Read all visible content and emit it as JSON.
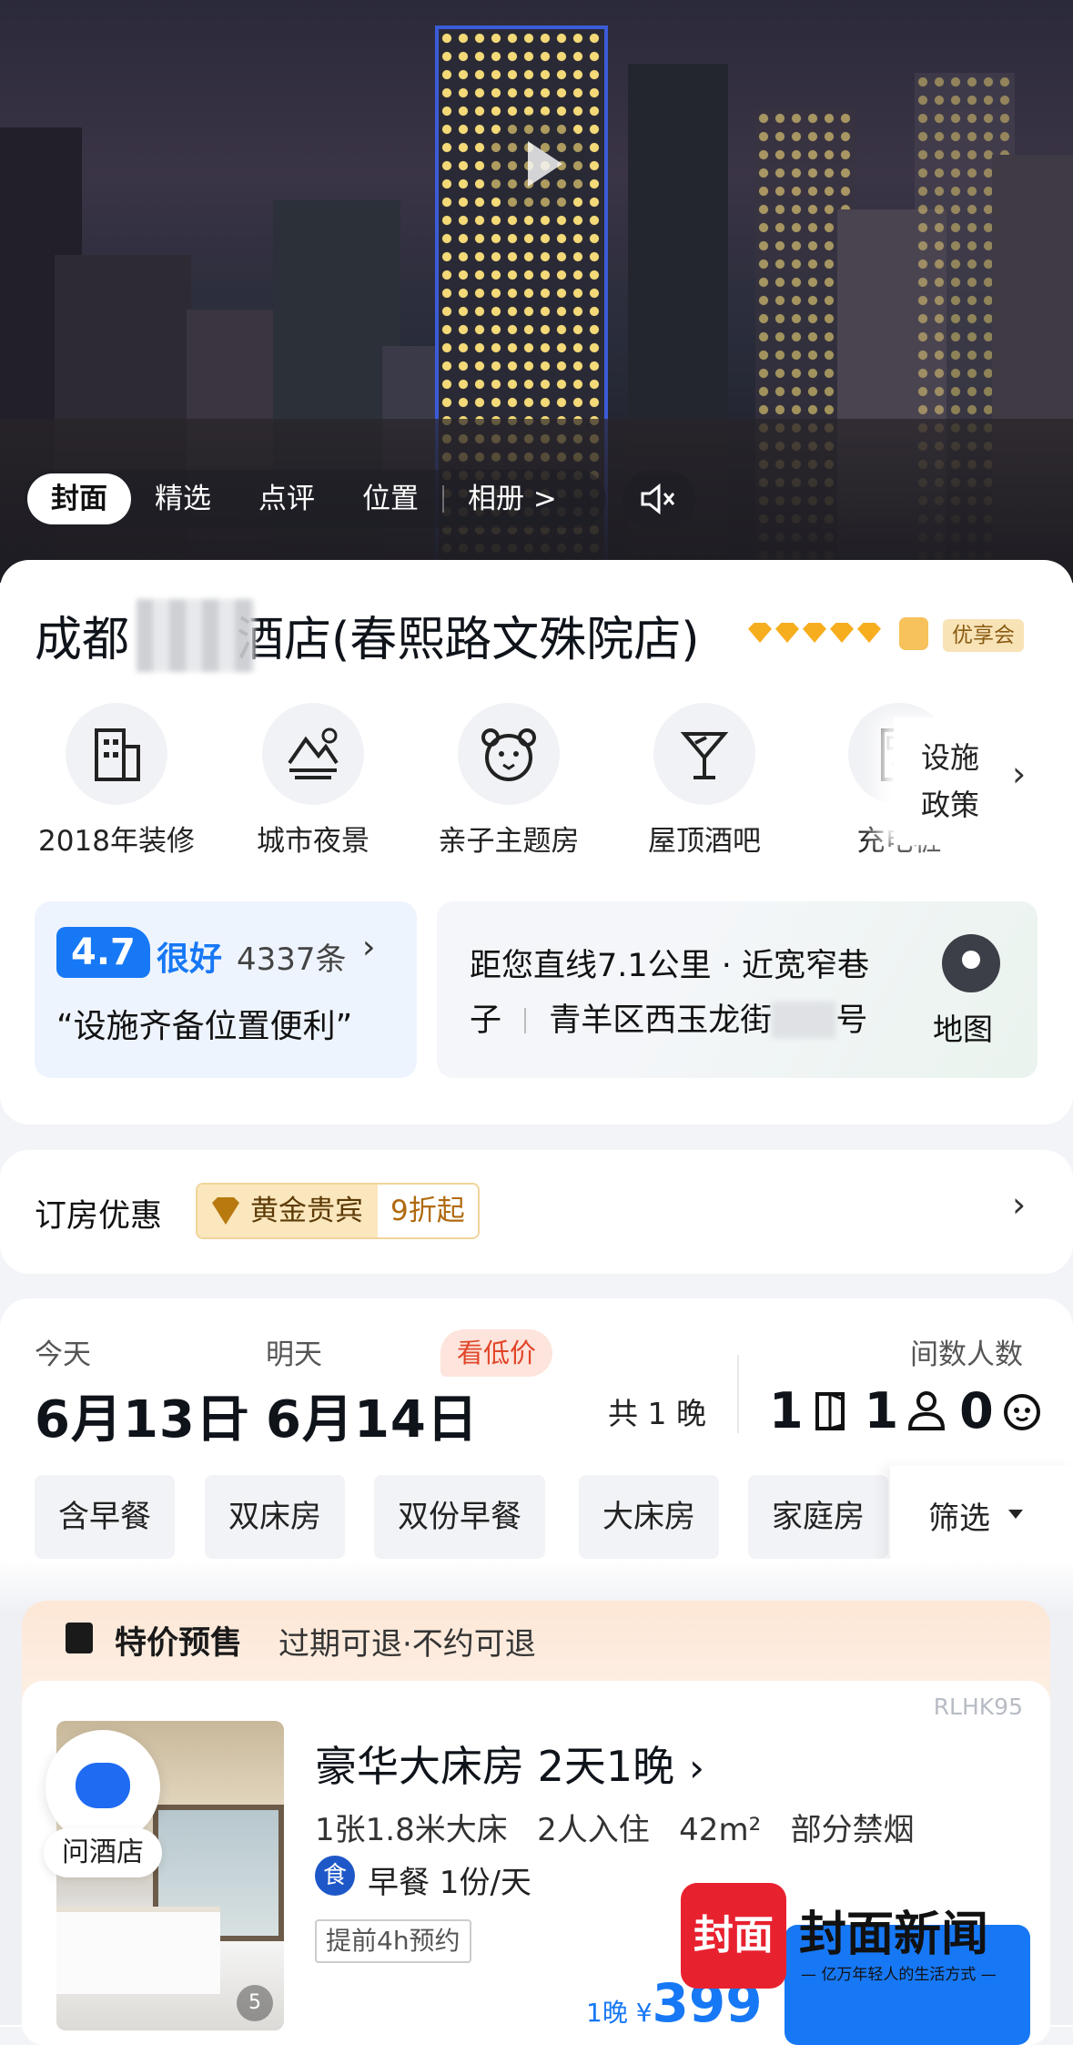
{
  "media_tabs": {
    "items": [
      "封面",
      "精选",
      "点评",
      "位置",
      "相册 >"
    ],
    "active": 0
  },
  "hotel": {
    "name": "成都▇▇▇酒店(春熙路文殊院店)",
    "name_visible_prefix": "成都",
    "name_visible_suffix": "酒店(春熙路文殊院店)",
    "star_count": 5,
    "membership_badge": "优享会"
  },
  "facilities": {
    "items": [
      {
        "label": "2018年装修",
        "icon": "building-icon"
      },
      {
        "label": "城市夜景",
        "icon": "night-view-icon"
      },
      {
        "label": "亲子主题房",
        "icon": "bear-icon"
      },
      {
        "label": "屋顶酒吧",
        "icon": "cocktail-icon"
      },
      {
        "label": "充电桩",
        "icon": "charging-icon"
      }
    ],
    "more_line1": "设施",
    "more_line2": "政策"
  },
  "rating": {
    "score": "4.7",
    "level": "很好",
    "count": "4337条",
    "quote": "“设施齐备位置便利”"
  },
  "location": {
    "line1": "距您直线7.1公里 · 近宽窄巷",
    "line2_a": "子",
    "line2_b": "青羊区西玉龙街",
    "line2_c": "号",
    "map_label": "地图"
  },
  "promo": {
    "label": "订房优惠",
    "tier": "黄金贵宾",
    "discount": "9折起"
  },
  "booking": {
    "checkin_label": "今天",
    "checkout_label": "明天",
    "low_price_tag": "看低价",
    "checkin_date": "6月13日",
    "dash": "-",
    "checkout_date": "6月14日",
    "nights": "共 1 晚",
    "rooms_people_label": "间数人数",
    "rooms": "1",
    "adults": "1",
    "children": "0"
  },
  "filters": {
    "chips": [
      "含早餐",
      "双床房",
      "双份早餐",
      "大床房",
      "家庭房"
    ],
    "filter_label": "筛选"
  },
  "presale": {
    "title": "特价预售",
    "terms": "过期可退·不约可退"
  },
  "room": {
    "code": "RLHK95",
    "title": "豪华大床房 2天1晚",
    "specs": "1张1.8米大床   2人入住   42m²   部分禁烟",
    "meal_badge": "食",
    "meal": "早餐 1份/天",
    "advance": "提前4h预约",
    "photo_count": "5",
    "price_prefix": "1晚 ¥",
    "price": "399"
  },
  "chat_button": {
    "label": "问酒店"
  },
  "watermark": {
    "logo": "封面",
    "name": "封面新闻",
    "slogan": "— 亿万年轻人的生活方式 —"
  },
  "colors": {
    "accent": "#1778f5",
    "gold_star": "#f6ae1f",
    "watermark_red": "#e8212f"
  }
}
